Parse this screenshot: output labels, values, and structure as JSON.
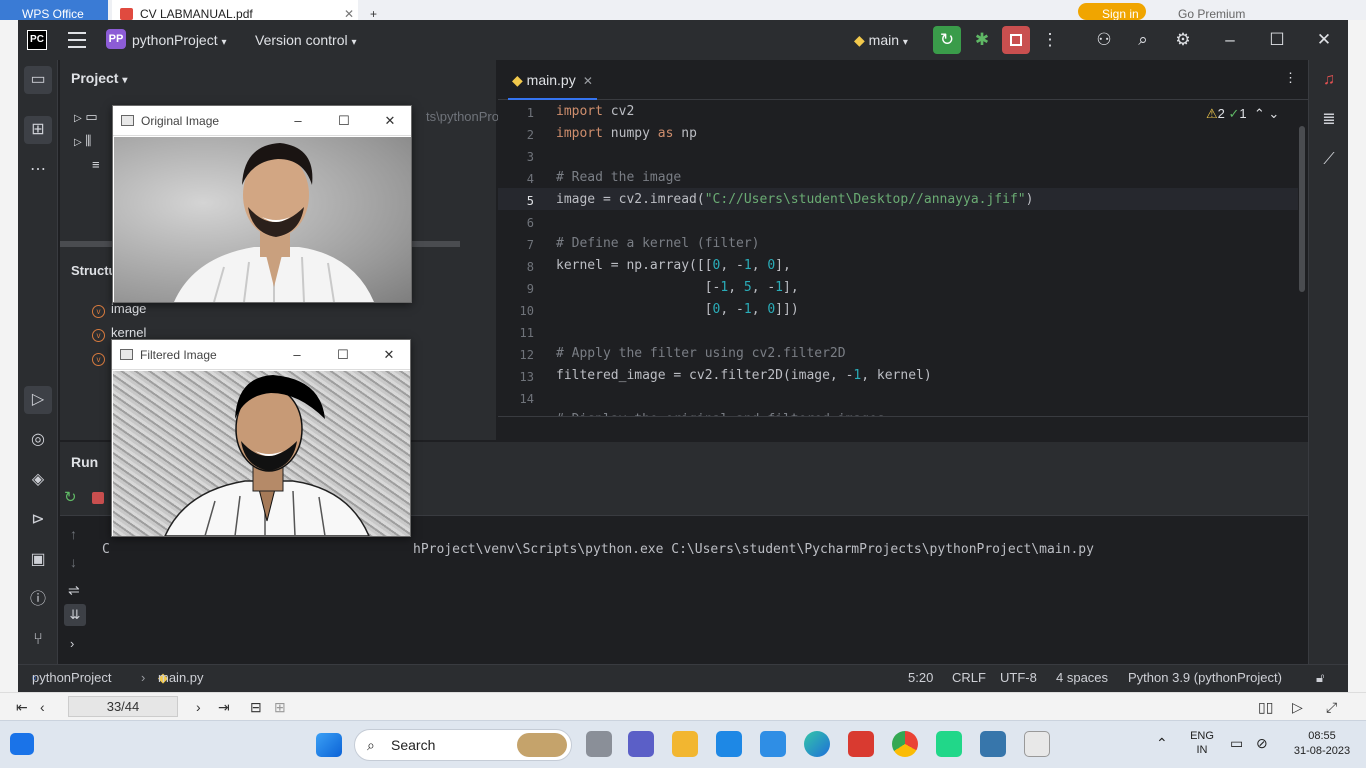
{
  "wps": {
    "office_label": "WPS Office",
    "doc_tab": "CV LABMANUAL.pdf",
    "sign_in": "Sign in",
    "go_premium": "Go Premium"
  },
  "ide": {
    "project_name": "pythonProject",
    "project_badge": "PP",
    "logo": "PC",
    "version_control": "Version control",
    "branch": "main",
    "project_label": "Project",
    "tree_path_fragment": "ts\\pythonPro",
    "structure_label": "Structu",
    "structure_items": [
      "image",
      "kernel"
    ],
    "editor_tab": "main.py",
    "inspection_warnings": "2",
    "inspection_ok": "1",
    "line_numbers": [
      "1",
      "2",
      "3",
      "4",
      "5",
      "6",
      "7",
      "8",
      "9",
      "10",
      "11",
      "12",
      "13",
      "14"
    ],
    "run_label": "Run",
    "console_prefix": "C",
    "console_text": "hProject\\venv\\Scripts\\python.exe C:\\Users\\student\\PycharmProjects\\pythonProject\\main.py",
    "status": {
      "breadcrumb_project": "pythonProject",
      "breadcrumb_file": "main.py",
      "position": "5:20",
      "line_ending": "CRLF",
      "encoding": "UTF-8",
      "indent": "4 spaces",
      "interpreter": "Python 3.9 (pythonProject)"
    }
  },
  "code": {
    "l1a": "import",
    "l1b": " cv2",
    "l2a": "import",
    "l2b": " numpy ",
    "l2c": "as",
    "l2d": " np",
    "l4": "# Read the image",
    "l5a": "image = cv2.imread(",
    "l5b": "\"C://Users\\student\\Desktop//annayya.jfif\"",
    "l5c": ")",
    "l7": "# Define a kernel (filter)",
    "l8a": "kernel = np.array([[",
    "l8b": "0",
    ", -": ", -",
    "l8c": "1",
    "l8d": "0",
    "l9a": "                   [-",
    "l9b": "1",
    "l9c": "5",
    "l9d": "1",
    "l10a": "                   [",
    "l10b": "0",
    "l10c": "1",
    "l10d": "0",
    "l12": "# Apply the filter using cv2.filter2D",
    "l13a": "filtered_image = cv2.filter2D(image, -",
    "l13b": "1",
    "l13c": ", kernel)",
    "l15": "# Display the original and filtered images"
  },
  "windows": {
    "original_title": "Original Image",
    "filtered_title": "Filtered Image"
  },
  "pdf": {
    "page": "33/44"
  },
  "taskbar": {
    "search": "Search",
    "lang1": "ENG",
    "lang2": "IN",
    "time": "08:55",
    "date": "31-08-2023"
  },
  "colors": {
    "accent": "#3574f0",
    "run": "#3a9c4a",
    "stop": "#c94f4f",
    "wps_blue": "#3a7bd5"
  }
}
